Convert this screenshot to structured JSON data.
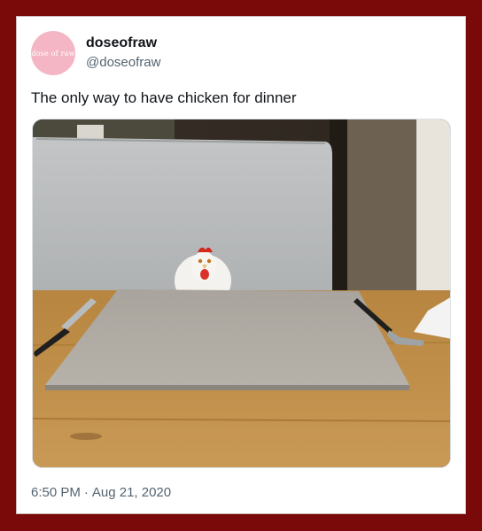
{
  "tweet": {
    "avatar_text": "dose of raw",
    "display_name": "doseofraw",
    "handle": "@doseofraw",
    "text": "The only way to have chicken for dinner",
    "time": "6:50 PM",
    "separator": "·",
    "date": "Aug 21, 2020"
  },
  "colors": {
    "frame_border": "#7a0a0a",
    "avatar_bg": "#f4b6c4",
    "muted_text": "#536471",
    "primary_text": "#0f1419"
  }
}
